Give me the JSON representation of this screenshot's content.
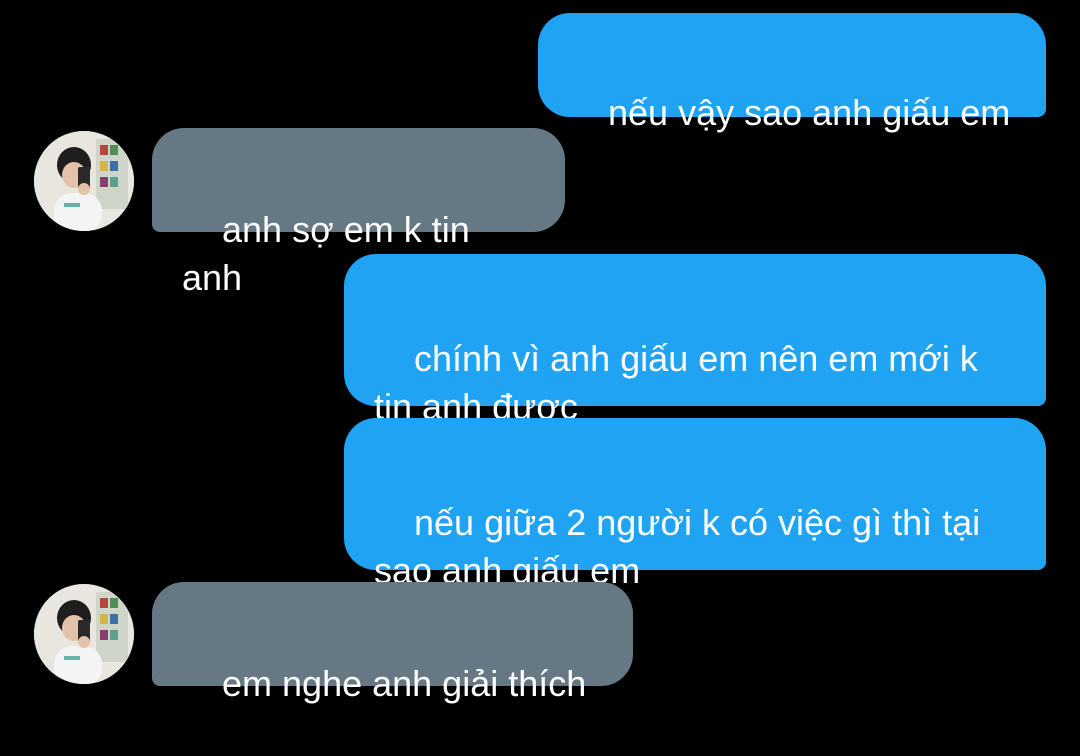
{
  "messages": [
    {
      "id": "m1",
      "direction": "sent",
      "text": "nếu vậy sao anh giấu em"
    },
    {
      "id": "m2",
      "direction": "received",
      "text": "anh sợ em k tin anh"
    },
    {
      "id": "m3",
      "direction": "sent",
      "text": "chính vì anh giấu em nên em mới k\ntin anh được"
    },
    {
      "id": "m4",
      "direction": "sent",
      "text": "nếu giữa 2 người k có việc gì thì tại\nsao anh giấu em"
    },
    {
      "id": "m5",
      "direction": "received",
      "text": "em nghe anh giải thích"
    }
  ],
  "colors": {
    "background": "#000000",
    "sent_bubble": "#1fa3f2",
    "received_bubble": "#677885",
    "text": "#ffffff"
  },
  "icons": {
    "avatar": "contact-avatar-photo"
  }
}
